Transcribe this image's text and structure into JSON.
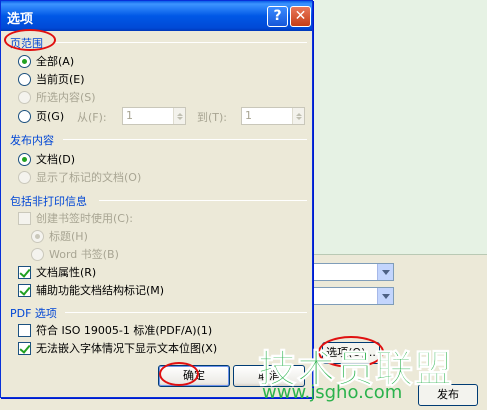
{
  "dialog": {
    "title": "选项",
    "help_glyph": "?",
    "close_glyph": "✕"
  },
  "page_range": {
    "title": "页范围",
    "all": "全部(A)",
    "current": "当前页(E)",
    "selection": "所选内容(S)",
    "pages": "页(G)",
    "from_label": "从(F):",
    "from_value": "1",
    "to_label": "到(T):",
    "to_value": "1"
  },
  "publish_what": {
    "title": "发布内容",
    "document": "文档(D)",
    "markup": "显示了标记的文档(O)"
  },
  "nonprint": {
    "title": "包括非打印信息",
    "create_bookmarks": "创建书签时使用(C):",
    "headings": "标题(H)",
    "word_bookmarks": "Word 书签(B)",
    "doc_properties": "文档属性(R)",
    "structure_tags": "辅助功能文档结构标记(M)"
  },
  "pdf": {
    "title": "PDF 选项",
    "iso": "符合 ISO 19005-1 标准(PDF/A)(1)",
    "bitmap": "无法嵌入字体情况下显示文本位图(X)"
  },
  "buttons": {
    "ok": "确定",
    "cancel": "取消"
  },
  "background": {
    "options_button": "选项(O)...",
    "publish_button": "发布"
  },
  "watermark": {
    "text": "技术员联盟",
    "url": "www.jsgho.com"
  },
  "colors": {
    "accent": "#0046d5",
    "annotation": "#e01010",
    "watermark": "#2bb24c"
  }
}
